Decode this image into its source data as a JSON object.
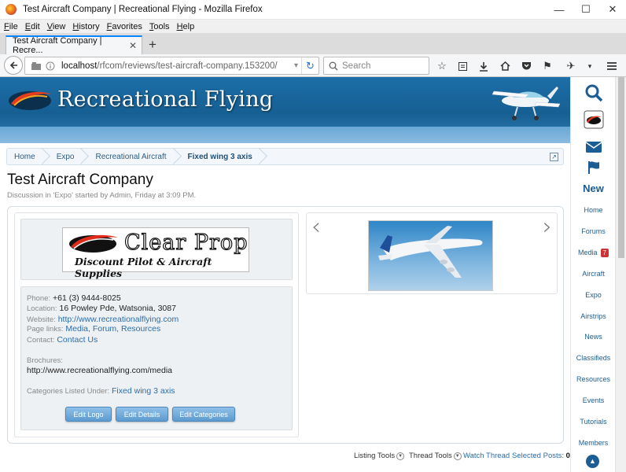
{
  "window": {
    "title": "Test Aircraft Company | Recreational Flying - Mozilla Firefox",
    "minimize_glyph": "—",
    "maximize_glyph": "☐",
    "close_glyph": "✕"
  },
  "menu": [
    "File",
    "Edit",
    "View",
    "History",
    "Favorites",
    "Tools",
    "Help"
  ],
  "tab": {
    "label": "Test Aircraft Company | Recre...",
    "close_glyph": "✕",
    "new_glyph": "+"
  },
  "navbar": {
    "url_host": "localhost",
    "url_path": "/rfcom/reviews/test-aircraft-company.153200/",
    "search_placeholder": "Search"
  },
  "site": {
    "title": "Recreational Flying"
  },
  "breadcrumb": [
    "Home",
    "Expo",
    "Recreational Aircraft",
    "Fixed wing 3 axis"
  ],
  "thread": {
    "title": "Test Aircraft Company",
    "description": "Discussion in 'Expo' started by Admin, Friday at 3:09 PM."
  },
  "ad": {
    "line1": "Clear Prop",
    "line2": "Discount Pilot & Aircraft Supplies"
  },
  "info": {
    "phone_label": "Phone:",
    "phone": "+61 (3) 9444-8025",
    "location_label": "Location:",
    "location": "16 Powley Pde, Watsonia, 3087",
    "website_label": "Website:",
    "website": "http://www.recreationalflying.com",
    "pagelinks_label": "Page links:",
    "pagelinks": "Media, Forum, Resources",
    "contact_label": "Contact:",
    "contact": "Contact Us",
    "brochures_label": "Brochures:",
    "brochures": "http://www.recreationalflying.com/media",
    "categories_label": "Categories Listed Under:",
    "categories": "Fixed wing 3 axis"
  },
  "buttons": {
    "edit_logo": "Edit Logo",
    "edit_details": "Edit Details",
    "edit_categories": "Edit Categories"
  },
  "footer": {
    "listing_tools": "Listing Tools",
    "thread_tools": "Thread Tools",
    "watch_thread": "Watch Thread",
    "selected_posts": "Selected Posts:",
    "selected_count": "0"
  },
  "sidebar": {
    "new_label": "New",
    "items": [
      "Home",
      "Forums",
      "Media",
      "Aircraft",
      "Expo",
      "Airstrips",
      "News",
      "Classifieds",
      "Resources",
      "Events",
      "Tutorials",
      "Members"
    ],
    "media_badge": "7"
  },
  "colors": {
    "header_blue": "#1d6ea8",
    "link_blue": "#2b6da7",
    "badge_red": "#cc3333"
  }
}
